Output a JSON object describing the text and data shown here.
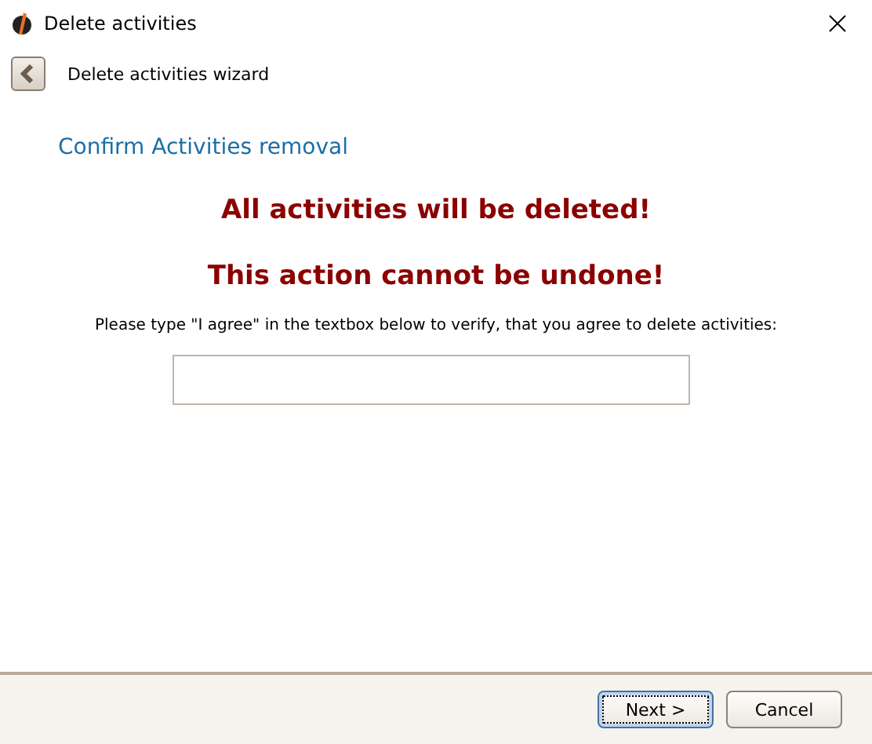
{
  "window": {
    "title": "Delete activities"
  },
  "header": {
    "title": "Delete activities wizard"
  },
  "heading": "Confirm Activities removal",
  "warnings": [
    "All activities will be deleted!",
    "This action cannot be undone!"
  ],
  "instruction": "Please type \"I agree\" in the textbox below to verify, that you agree to delete activities:",
  "buttons": [
    {
      "label": "Next >",
      "focused": true
    },
    {
      "label": "Cancel",
      "focused": false
    }
  ]
}
